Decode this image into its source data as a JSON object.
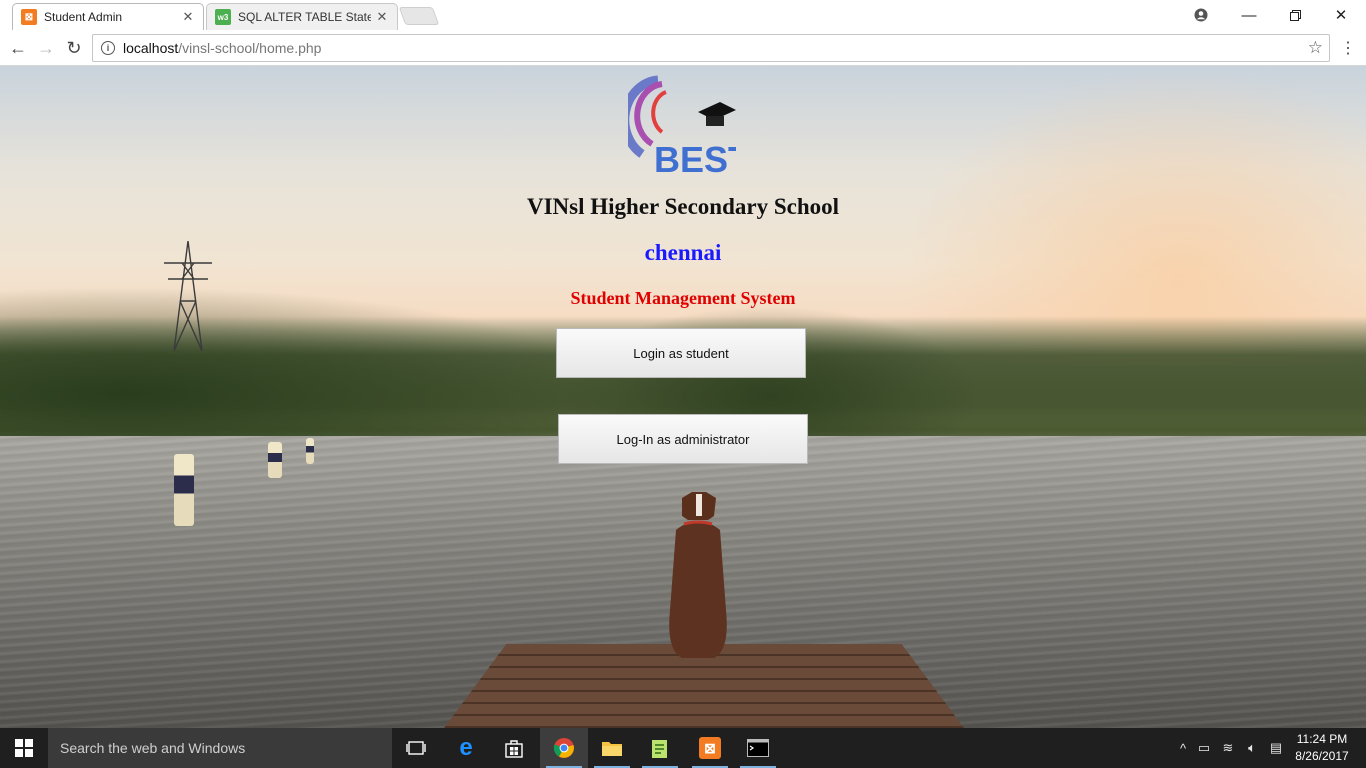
{
  "browser": {
    "tabs": [
      {
        "title": "Student Admin",
        "icon": "xampp-icon",
        "active": true
      },
      {
        "title": "SQL ALTER TABLE Statem",
        "icon": "w3schools-icon",
        "active": false
      }
    ],
    "address": {
      "host": "localhost",
      "path": "/vinsl-school/home.php"
    }
  },
  "page": {
    "logo_text": "BEST",
    "school_name": "VINsl Higher Secondary School",
    "city": "chennai",
    "system_title": "Student Management System",
    "buttons": {
      "student": "Login as student",
      "admin": "Log-In as administrator"
    }
  },
  "taskbar": {
    "search_placeholder": "Search the web and Windows",
    "pinned": [
      "task-view-icon",
      "edge-icon",
      "store-icon",
      "chrome-icon",
      "file-explorer-icon",
      "notepad-plus-icon",
      "xampp-icon",
      "cmd-icon"
    ],
    "time": "11:24 PM",
    "date": "8/26/2017"
  },
  "colors": {
    "city": "#1a1aff",
    "system_title": "#e00000",
    "taskbar": "#1f1f1f"
  }
}
